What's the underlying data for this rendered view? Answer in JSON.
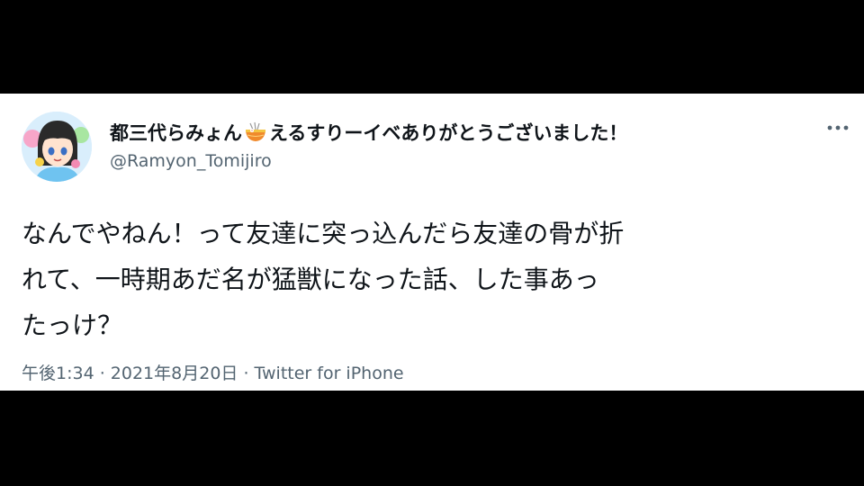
{
  "tweet": {
    "display_name_prefix": "都三代らみょん",
    "display_name_suffix": "えるすりーイベありがとうございました！",
    "emoji": "ramen-bowl-icon",
    "handle": "@Ramyon_Tomijiro",
    "more_label": "…",
    "text_lines": [
      "なんでやねん！って友達に突っ込んだら友達の骨が折",
      "れて、一時期あだ名が猛獣になった話、した事あっ",
      "たっけ？"
    ],
    "time": "午後1:34",
    "separator": " · ",
    "date": "2021年8月20日",
    "source": "Twitter for iPhone"
  },
  "colors": {
    "background": "#000000",
    "card": "#ffffff",
    "text": "#0f1419",
    "muted": "#536471"
  }
}
